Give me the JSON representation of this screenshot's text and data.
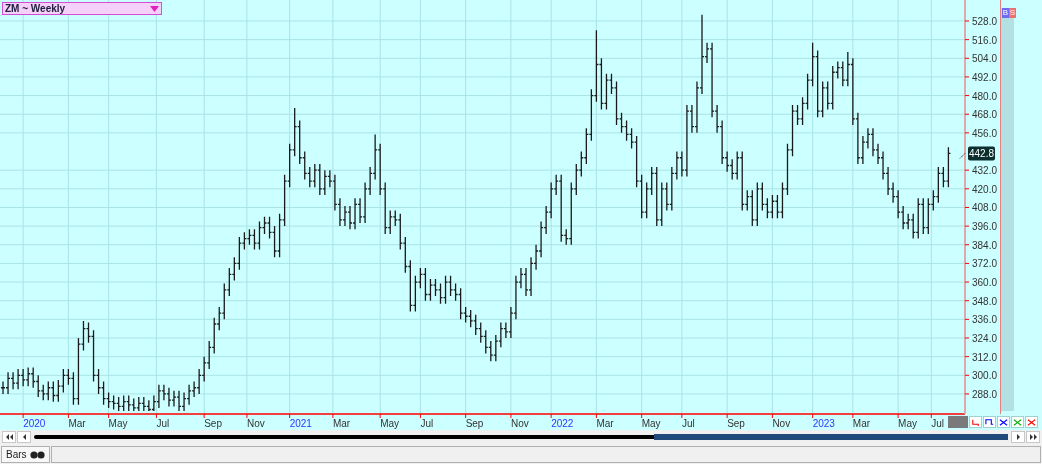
{
  "symbol_selector": {
    "value": "ZM ~ Weekly"
  },
  "trade_buttons": [
    {
      "label": "B",
      "kind": "buy"
    },
    {
      "label": "S",
      "kind": "sell"
    }
  ],
  "chart": {
    "last_price": "442.8",
    "y_axis_labels": [
      "528.0",
      "516.0",
      "504.0",
      "492.0",
      "480.0",
      "468.0",
      "456.0",
      "432.0",
      "420.0",
      "408.0",
      "396.0",
      "384.0",
      "372.0",
      "360.0",
      "348.0",
      "336.0",
      "324.0",
      "312.0",
      "300.0",
      "288.0"
    ],
    "x_axis_labels": [
      {
        "label": "2020",
        "kind": "year"
      },
      {
        "label": "Mar",
        "kind": "month"
      },
      {
        "label": "May",
        "kind": "month"
      },
      {
        "label": "Jul",
        "kind": "month"
      },
      {
        "label": "Sep",
        "kind": "month"
      },
      {
        "label": "Nov",
        "kind": "month"
      },
      {
        "label": "2021",
        "kind": "year"
      },
      {
        "label": "Mar",
        "kind": "month"
      },
      {
        "label": "May",
        "kind": "month"
      },
      {
        "label": "Jul",
        "kind": "month"
      },
      {
        "label": "Sep",
        "kind": "month"
      },
      {
        "label": "Nov",
        "kind": "month"
      },
      {
        "label": "2022",
        "kind": "year"
      },
      {
        "label": "Mar",
        "kind": "month"
      },
      {
        "label": "May",
        "kind": "month"
      },
      {
        "label": "Jul",
        "kind": "month"
      },
      {
        "label": "Sep",
        "kind": "month"
      },
      {
        "label": "Nov",
        "kind": "month"
      },
      {
        "label": "2023",
        "kind": "year"
      },
      {
        "label": "Mar",
        "kind": "month"
      },
      {
        "label": "May",
        "kind": "month"
      },
      {
        "label": "Jul",
        "kind": "month"
      }
    ]
  },
  "bottom_tab": {
    "label": "Bars"
  }
}
